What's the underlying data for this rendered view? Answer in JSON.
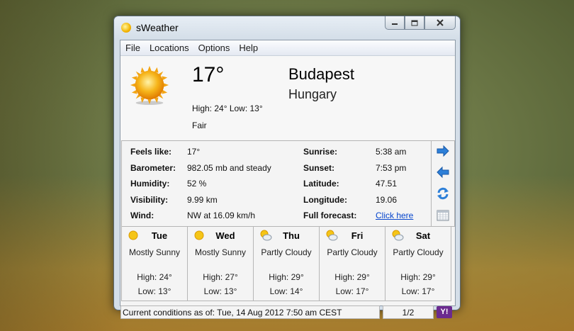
{
  "window": {
    "title": "sWeather"
  },
  "menu": [
    "File",
    "Locations",
    "Options",
    "Help"
  ],
  "current": {
    "temperature": "17°",
    "high_low": "High: 24° Low: 13°",
    "condition": "Fair",
    "city": "Budapest",
    "country": "Hungary"
  },
  "details_left": [
    {
      "label": "Feels like:",
      "value": "17°"
    },
    {
      "label": "Barometer:",
      "value": "982.05 mb and steady"
    },
    {
      "label": "Humidity:",
      "value": "52 %"
    },
    {
      "label": "Visibility:",
      "value": "9.99 km"
    },
    {
      "label": "Wind:",
      "value": "NW at 16.09 km/h"
    }
  ],
  "details_right": [
    {
      "label": "Sunrise:",
      "value": "5:38 am"
    },
    {
      "label": "Sunset:",
      "value": "7:53 pm"
    },
    {
      "label": "Latitude:",
      "value": "47.51"
    },
    {
      "label": "Longitude:",
      "value": "19.06"
    },
    {
      "label": "Full forecast:",
      "value": "Click here"
    }
  ],
  "side_buttons": [
    "arrow-right-icon",
    "arrow-left-icon",
    "refresh-icon",
    "calendar-icon"
  ],
  "forecast": [
    {
      "day": "Tue",
      "condition": "Mostly Sunny",
      "high": "High: 24°",
      "low": "Low: 13°",
      "icon": "sun-icon"
    },
    {
      "day": "Wed",
      "condition": "Mostly Sunny",
      "high": "High: 27°",
      "low": "Low: 13°",
      "icon": "sun-icon"
    },
    {
      "day": "Thu",
      "condition": "Partly Cloudy",
      "high": "High: 29°",
      "low": "Low: 14°",
      "icon": "partly-cloudy-icon"
    },
    {
      "day": "Fri",
      "condition": "Partly Cloudy",
      "high": "High: 29°",
      "low": "Low: 17°",
      "icon": "partly-cloudy-icon"
    },
    {
      "day": "Sat",
      "condition": "Partly Cloudy",
      "high": "High: 29°",
      "low": "Low: 17°",
      "icon": "partly-cloudy-icon"
    }
  ],
  "status": {
    "conditions": "Current conditions as of: Tue, 14 Aug 2012 7:50 am CEST",
    "page": "1/2",
    "yahoo": "Y!"
  },
  "colors": {
    "link": "#0645cc",
    "yahoo": "#6b2a8f",
    "arrow": "#2d7fd8"
  }
}
